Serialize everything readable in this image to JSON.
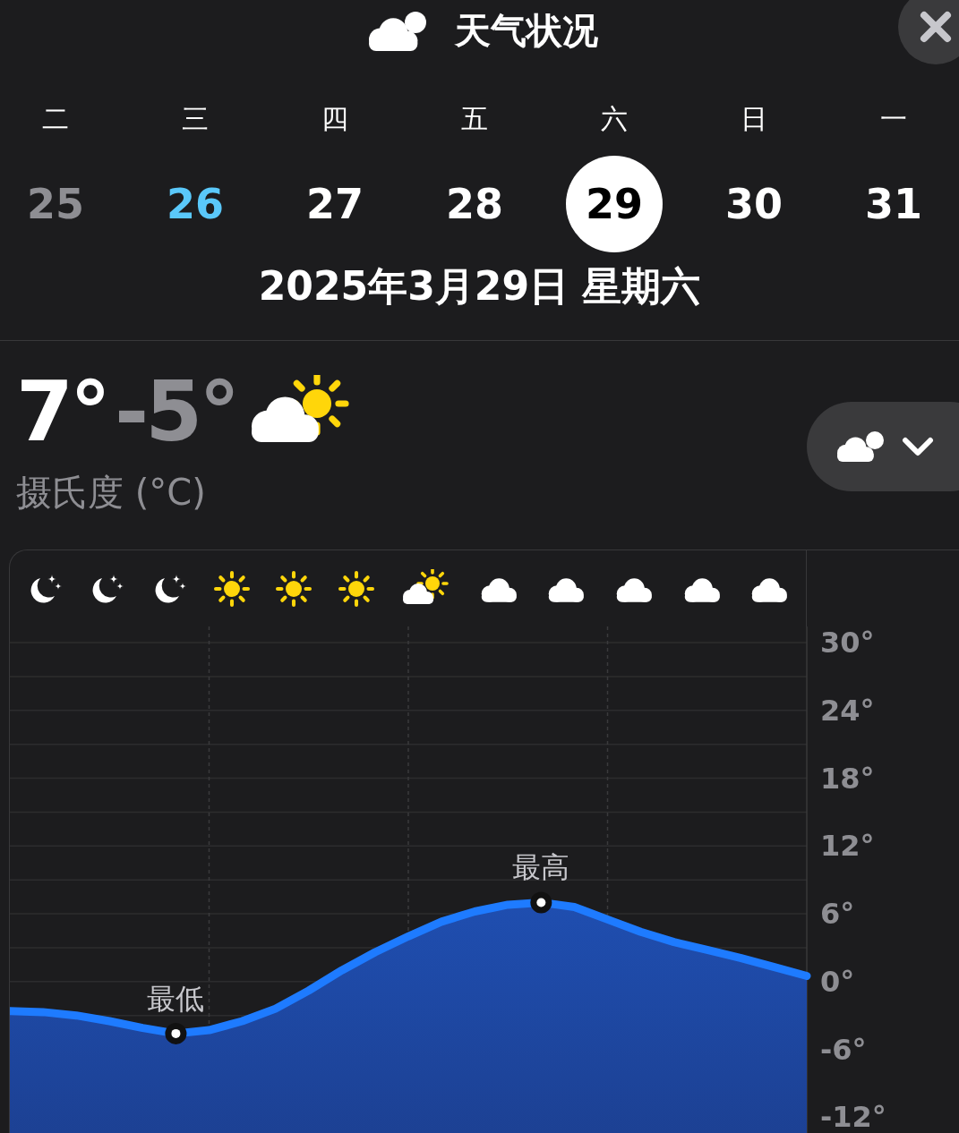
{
  "header": {
    "title": "天气状况"
  },
  "days": [
    {
      "weekday": "二",
      "date": "25",
      "selected": false,
      "today": false,
      "past": true
    },
    {
      "weekday": "三",
      "date": "26",
      "selected": false,
      "today": true,
      "past": false
    },
    {
      "weekday": "四",
      "date": "27",
      "selected": false,
      "today": false,
      "past": false
    },
    {
      "weekday": "五",
      "date": "28",
      "selected": false,
      "today": false,
      "past": false
    },
    {
      "weekday": "六",
      "date": "29",
      "selected": true,
      "today": false,
      "past": false
    },
    {
      "weekday": "日",
      "date": "30",
      "selected": false,
      "today": false,
      "past": false
    },
    {
      "weekday": "一",
      "date": "31",
      "selected": false,
      "today": false,
      "past": false
    }
  ],
  "full_date": "2025年3月29日 星期六",
  "summary": {
    "high": "7°",
    "low": "-5°",
    "unit": "摄氏度 (°C)"
  },
  "hourly_icons": [
    {
      "kind": "moon"
    },
    {
      "kind": "moon"
    },
    {
      "kind": "moon"
    },
    {
      "kind": "sun"
    },
    {
      "kind": "sun"
    },
    {
      "kind": "sun"
    },
    {
      "kind": "partly"
    },
    {
      "kind": "cloud"
    },
    {
      "kind": "cloud"
    },
    {
      "kind": "cloud"
    },
    {
      "kind": "cloud"
    },
    {
      "kind": "cloud"
    }
  ],
  "chart_labels": {
    "min": "最低",
    "max": "最高"
  },
  "chart_data": {
    "type": "area",
    "categories": [
      null,
      null,
      null,
      null,
      null,
      null,
      null,
      null,
      null,
      null,
      null,
      null,
      null,
      null,
      null,
      null,
      null,
      null,
      null,
      null,
      null,
      null,
      null,
      null,
      null
    ],
    "series": [
      {
        "color": "#1e7bff",
        "values": [
          -2.6,
          -2.7,
          -3,
          -3.5,
          -4.1,
          -4.6,
          -4.3,
          -3.5,
          -2.4,
          -0.8,
          1,
          2.6,
          4,
          5.3,
          6.2,
          6.8,
          7,
          6.6,
          5.5,
          4.4,
          3.5,
          2.8,
          2.1,
          1.3,
          0.5
        ]
      }
    ],
    "ylim": [
      -13.4,
      30
    ],
    "grid": true,
    "yticks": [
      {
        "value": 30,
        "label": "30°"
      },
      {
        "value": 24,
        "label": "24°"
      },
      {
        "value": 18,
        "label": "18°"
      },
      {
        "value": 12,
        "label": "12°"
      },
      {
        "value": 6,
        "label": "6°"
      },
      {
        "value": 0,
        "label": "0°"
      },
      {
        "value": -6,
        "label": "-6°"
      },
      {
        "value": -12,
        "label": "-12°"
      }
    ]
  }
}
